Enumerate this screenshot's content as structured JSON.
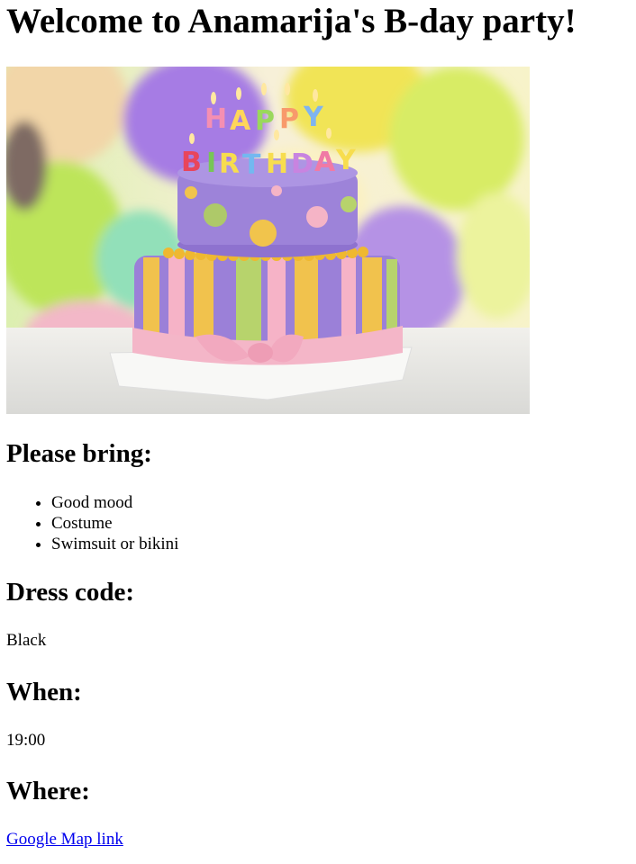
{
  "page": {
    "title": "Welcome to Anamarija's B-day party!",
    "hero_image": {
      "alt": "Birthday cake",
      "candle_text_line1": "HAPPY",
      "candle_text_line2": "BIRTHDAY",
      "colors": {
        "balloon_purple": "#a979e0",
        "balloon_yellow": "#f3e34a",
        "balloon_green": "#c6e858",
        "cake_purple": "#9b7fd8",
        "cake_pink": "#f6b4c8",
        "cake_yellow": "#f1c44c",
        "cake_green": "#b6d36a",
        "board": "#f4f4f4"
      }
    },
    "bring": {
      "heading": "Please bring:",
      "items": [
        "Good mood",
        "Costume",
        "Swimsuit or bikini"
      ]
    },
    "dress_code": {
      "heading": "Dress code:",
      "value": "Black"
    },
    "when": {
      "heading": "When:",
      "value": "19:00"
    },
    "where": {
      "heading": "Where:",
      "link_text": "Google Map link",
      "link_href": "#"
    }
  }
}
